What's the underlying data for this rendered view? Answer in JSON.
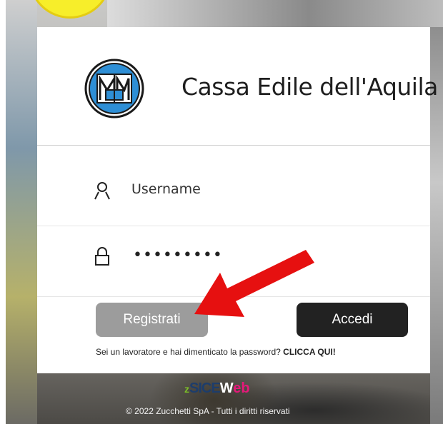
{
  "org": {
    "name": "Cassa Edile dell'Aquila"
  },
  "login": {
    "username_placeholder": "Username",
    "password_masked": "•••••••••",
    "register_label": "Registrati",
    "login_label": "Accedi",
    "forgot_prefix": "Sei un lavoratore e hai dimenticato la password?",
    "forgot_link": "CLICCA QUI!"
  },
  "footer": {
    "brand_z": "z",
    "brand_sice": "SICE",
    "brand_w": "W",
    "brand_eb": "eb",
    "copyright": "© 2022 Zucchetti SpA - Tutti i diritti riservati"
  },
  "colors": {
    "register_button": "#9c9c9c",
    "login_button": "#222222",
    "annotation_arrow": "#e61010",
    "highlight_yellow": "#f7ee2a"
  },
  "icons": {
    "user": "user-icon",
    "lock": "lock-icon"
  }
}
